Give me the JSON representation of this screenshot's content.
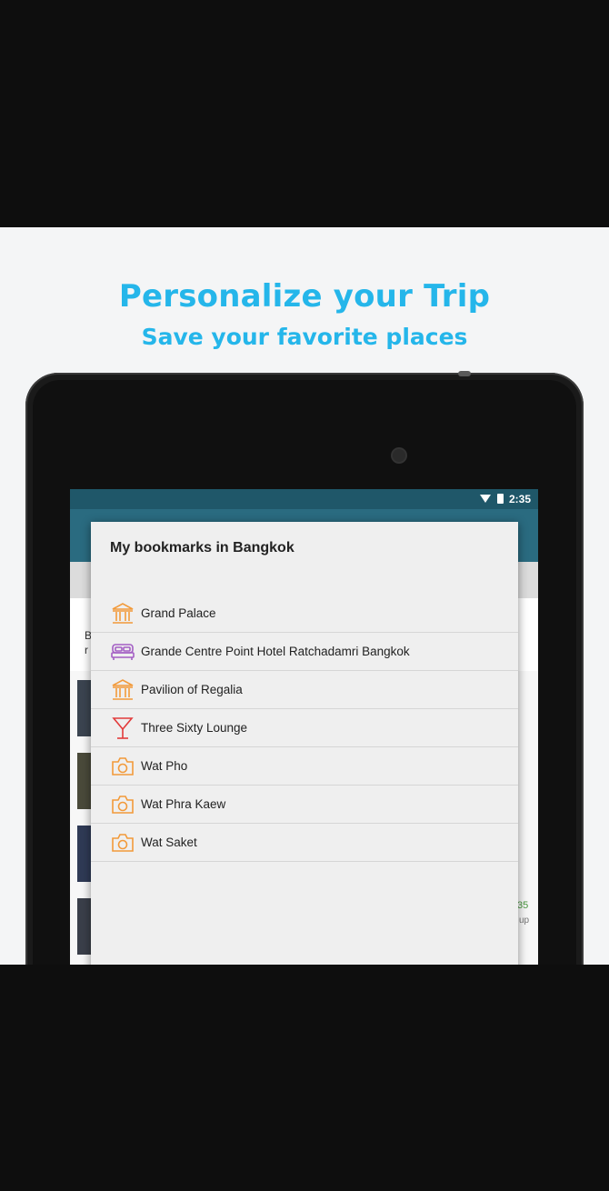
{
  "promo": {
    "title": "Personalize your Trip",
    "subtitle": "Save your favorite places"
  },
  "statusbar": {
    "time": "2:35",
    "icons": [
      "wifi-icon",
      "battery-icon"
    ]
  },
  "dialog": {
    "title": "My bookmarks in Bangkok",
    "items": [
      {
        "label": "Grand Palace",
        "icon": "landmark-icon",
        "color": "#f29a3a"
      },
      {
        "label": "Grande Centre Point Hotel Ratchadamri Bangkok",
        "icon": "hotel-bed-icon",
        "color": "#a35ec4"
      },
      {
        "label": "Pavilion of Regalia",
        "icon": "landmark-icon",
        "color": "#f29a3a"
      },
      {
        "label": "Three Sixty Lounge",
        "icon": "cocktail-icon",
        "color": "#e23b3b"
      },
      {
        "label": "Wat Pho",
        "icon": "camera-icon",
        "color": "#f29a3a"
      },
      {
        "label": "Wat Phra Kaew",
        "icon": "camera-icon",
        "color": "#f29a3a"
      },
      {
        "label": "Wat Saket",
        "icon": "camera-icon",
        "color": "#f29a3a"
      }
    ]
  },
  "background": {
    "partial_text": [
      "B",
      "r",
      "35",
      "up"
    ]
  },
  "colors": {
    "accent": "#25b6ea",
    "appbar": "#2a6b80",
    "statusbar": "#1f5769"
  }
}
